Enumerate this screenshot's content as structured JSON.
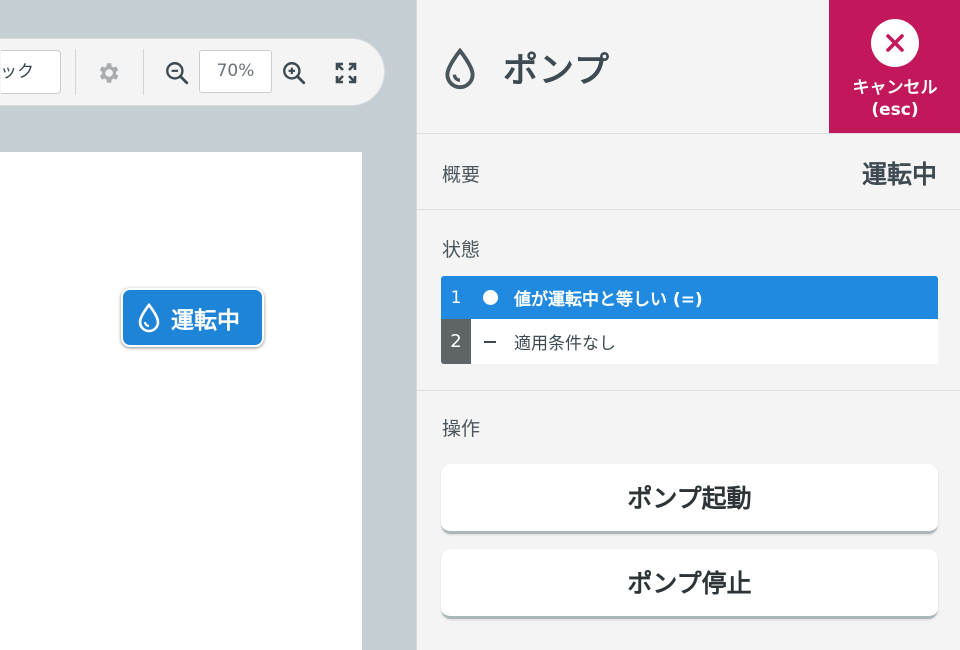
{
  "toolbar": {
    "lock_label": "ロック",
    "zoom_value": "70%"
  },
  "canvas": {
    "widget_label": "運転中"
  },
  "panel": {
    "title": "ポンプ",
    "cancel_label_line1": "キャンセル",
    "cancel_label_line2": "(esc)",
    "summary": {
      "label": "概要",
      "value": "運転中"
    },
    "states": {
      "label": "状態",
      "items": [
        {
          "num": "1",
          "text": "値が運転中と等しい (=)"
        },
        {
          "num": "2",
          "text": "適用条件なし"
        }
      ]
    },
    "operations": {
      "label": "操作",
      "buttons": [
        {
          "label": "ポンプ起動"
        },
        {
          "label": "ポンプ停止"
        }
      ]
    }
  },
  "colors": {
    "accent_blue": "#1e84d8",
    "cancel_red": "#c2185b",
    "canvas_bg": "#c5ced3",
    "panel_bg": "#f4f4f4"
  },
  "icons": {
    "title_icon": "water-drop-icon",
    "widget_icon": "water-drop-icon",
    "cancel_icon": "close-icon",
    "settings_icon": "gear-icon",
    "zoom_out_icon": "zoom-out-icon",
    "zoom_in_icon": "zoom-in-icon",
    "fullscreen_icon": "fullscreen-icon"
  }
}
